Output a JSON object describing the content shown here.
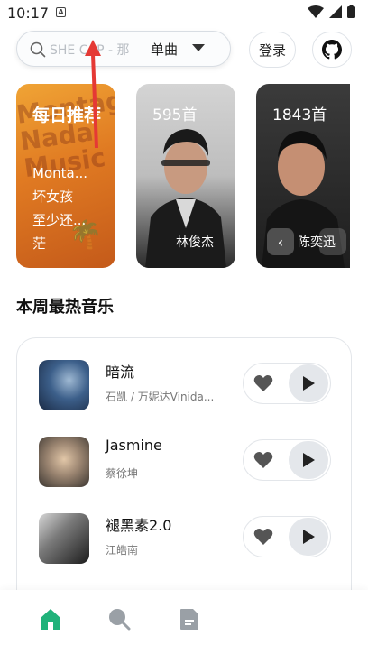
{
  "status_bar": {
    "time": "10:17",
    "notification_badge": "A"
  },
  "search": {
    "placeholder": "SHE CAP - 那",
    "type_label": "单曲"
  },
  "header": {
    "login_label": "登录"
  },
  "cards": [
    {
      "title": "每日推荐",
      "lines": [
        "Monta...",
        "坏女孩",
        "至少还...",
        "茫"
      ]
    },
    {
      "count": "595首",
      "artist": "林俊杰"
    },
    {
      "count": "1843首",
      "artist": "陈奕迅"
    }
  ],
  "section": {
    "title": "本周最热音乐"
  },
  "songs": [
    {
      "name": "暗流",
      "artist": "石凯 / 万妮达Vinida..."
    },
    {
      "name": "Jasmine",
      "artist": "蔡徐坤"
    },
    {
      "name": "褪黑素2.0",
      "artist": "江皓南"
    }
  ],
  "colors": {
    "accent": "#20b27a",
    "icon_gray": "#9aa0a6"
  },
  "nav": {
    "icons": [
      "home-icon",
      "search-icon",
      "document-icon"
    ],
    "active": "home-icon"
  }
}
